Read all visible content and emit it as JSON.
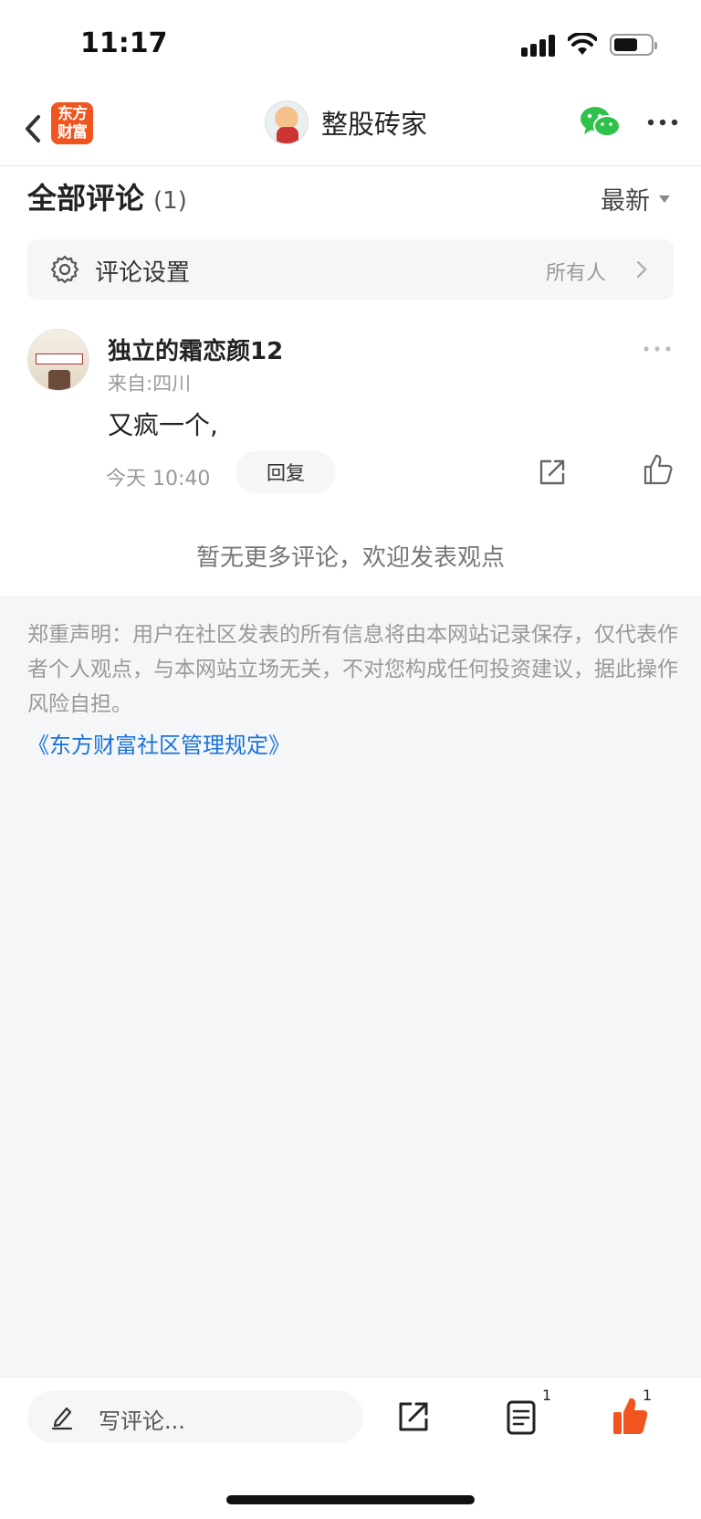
{
  "status_bar": {
    "time": "11:17"
  },
  "nav": {
    "brand_line1": "东方",
    "brand_line2": "财富",
    "title": "整股砖家"
  },
  "comments": {
    "title": "全部评论",
    "count": "(1)",
    "sort_label": "最新",
    "settings_label": "评论设置",
    "settings_value": "所有人",
    "items": [
      {
        "username": "独立的霜恋颜12",
        "location": "来自:四川",
        "text": "又疯一个,",
        "time": "今天 10:40",
        "reply_label": "回复"
      }
    ],
    "no_more_text": "暂无更多评论，欢迎发表观点"
  },
  "disclaimer": {
    "text": "郑重声明：用户在社区发表的所有信息将由本网站记录保存，仅代表作者个人观点，与本网站立场无关，不对您构成任何投资建议，据此操作风险自担。",
    "link_text": "《东方财富社区管理规定》"
  },
  "bottom_bar": {
    "input_placeholder": "写评论...",
    "comment_count": "1",
    "like_count": "1"
  },
  "colors": {
    "brand": "#f0541f",
    "link": "#1a73d9",
    "like_active": "#f0541f",
    "wechat": "#2ec24b"
  }
}
